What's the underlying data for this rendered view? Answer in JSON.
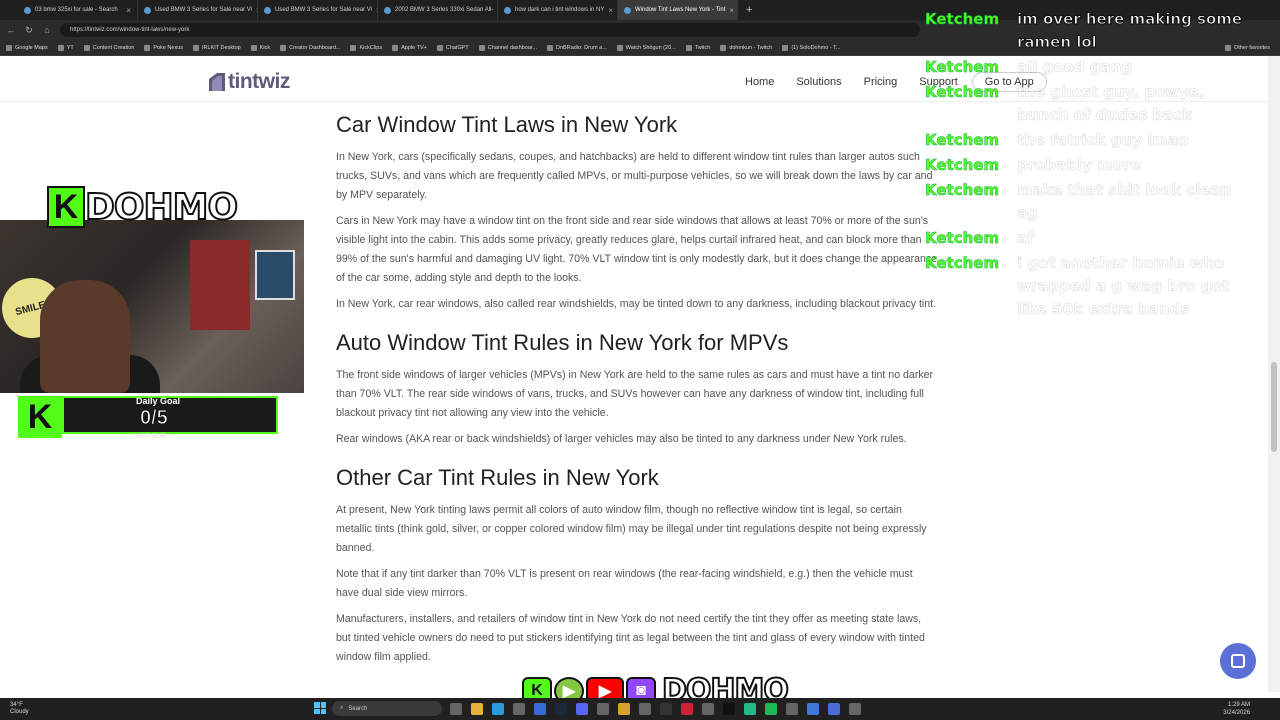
{
  "browser": {
    "tabs": [
      {
        "label": "03 bmw 325xi for sale - Search",
        "active": false
      },
      {
        "label": "Used BMW 3 Series for Sale near Vi",
        "active": false
      },
      {
        "label": "Used BMW 3 Series for Sale near Vi",
        "active": false
      },
      {
        "label": "2002 BMW 3 Series 330xi Sedan All-",
        "active": false
      },
      {
        "label": "how dark can i tint windows in NY",
        "active": false
      },
      {
        "label": "Window Tint Laws New York - Tint",
        "active": true
      }
    ],
    "new_tab": "+",
    "url": "https://tintwiz.com/window-tint-laws/new-york",
    "bookmarks": [
      "Google Maps",
      "YT",
      "Content Creation",
      "Poke Nexus",
      "IRLKIT Desktop",
      "Kick",
      "Creator Dashboard...",
      "KickClips",
      "Apple TV+",
      "ChatGPT",
      "Channel dashboar...",
      "DnBRadio: Drum a...",
      "Watch Shōgun (20...",
      "Twitch",
      "dohmkun - Twitch",
      "(1) SoloDohmo - T...",
      "Other favorites"
    ]
  },
  "site": {
    "logo": "tintwiz",
    "nav": [
      "Home",
      "Solutions",
      "Pricing",
      "Support"
    ],
    "cta": "Go to App",
    "sections": [
      {
        "heading": "Car Window Tint Laws in New York",
        "paragraphs": [
          "In New York, cars (specifically sedans, coupes, and hatchbacks) are held to different window tint rules than larger autos such trucks, SUVs, and vans which are frequently called MPVs, or multi-purpose vehicles, so we will break down the laws by car and by MPV separately.",
          "Cars in New York may have a window tint on the front side and rear side windows that allows at least 70% or more of the sun's visible light into the cabin. This adds some privacy, greatly reduces glare, helps curtail infrared heat, and can block more than 99% of the sun's harmful and damaging UV light. 70% VLT window tint is only modestly dark, but it does change the appearance of the car some, adding style and depth to the looks.",
          "In New York, car rear windows, also called rear windshields, may be tinted down to any darkness, including blackout privacy tint."
        ]
      },
      {
        "heading": "Auto Window Tint Rules in New York for MPVs",
        "paragraphs": [
          "The front side windows of larger vehicles (MPVs) in New York are held to the same rules as cars and must have a tint no darker than 70% VLT. The rear side windows of vans, trucks, and SUVs however can have any darkness of window tint, including full blackout privacy tint not allowing any view into the vehicle.",
          "Rear windows (AKA rear or back windshields) of larger vehicles may also be tinted to any darkness under New York rules."
        ]
      },
      {
        "heading": "Other Car Tint Rules in New York",
        "paragraphs": [
          "At present, New York tinting laws permit all colors of auto window film, though no reflective window tint is legal, so certain metallic tints (think gold, silver, or copper colored window film) may be illegal under tint regulations despite not being expressly banned.",
          "Note that if any tint darker than 70% VLT is present on rear windows (the rear-facing windshield, e.g.) then the vehicle must have dual side view mirrors.",
          "Manufacturers, installers, and retailers of window tint in New York do not need certify the tint they offer as meeting state laws, but tinted vehicle owners do need to put stickers identifying tint as legal between the tint and glass of every window with tinted window film applied."
        ]
      }
    ]
  },
  "overlay": {
    "streamer_name": "DOHMO",
    "k_glyph": "K",
    "webcam_sign": "SMILE!",
    "goal_label": "Daily Goal",
    "goal_count": "0/5",
    "goal_progress": 0,
    "last_sub": "LAST SUB: -",
    "chat": [
      {
        "name": "Ketchem",
        "text": "im over here making some ramen lol",
        "faded": false
      },
      {
        "name": "Ketchem",
        "text": "all good gang",
        "faded": true
      },
      {
        "name": "Ketchem",
        "text": "the ghost guy, powye, bunch of dudes back",
        "faded": true
      },
      {
        "name": "Ketchem",
        "text": "the fatrick guy lmao",
        "faded": true
      },
      {
        "name": "Ketchem",
        "text": "probably more",
        "faded": true
      },
      {
        "name": "Ketchem",
        "text": "make that shit look clean ag",
        "faded": true
      },
      {
        "name": "Ketchem",
        "text": "af",
        "faded": true
      },
      {
        "name": "Ketchem",
        "text": "i got another homie who wrapped a g wag bro got like 50k extra bands",
        "faded": true
      }
    ],
    "socials_name": "DOHMO",
    "social_icons": [
      "kick-icon",
      "rumble-icon",
      "youtube-icon",
      "twitch-icon"
    ]
  },
  "taskbar": {
    "weather_temp": "34°F",
    "weather_desc": "Cloudy",
    "search_placeholder": "Search",
    "time": "1:29 AM",
    "date": "3/24/2026"
  },
  "colors": {
    "kick_green": "#53fc18",
    "brand_purple": "#5d5a7a",
    "chat_button": "#5b6fd6"
  }
}
